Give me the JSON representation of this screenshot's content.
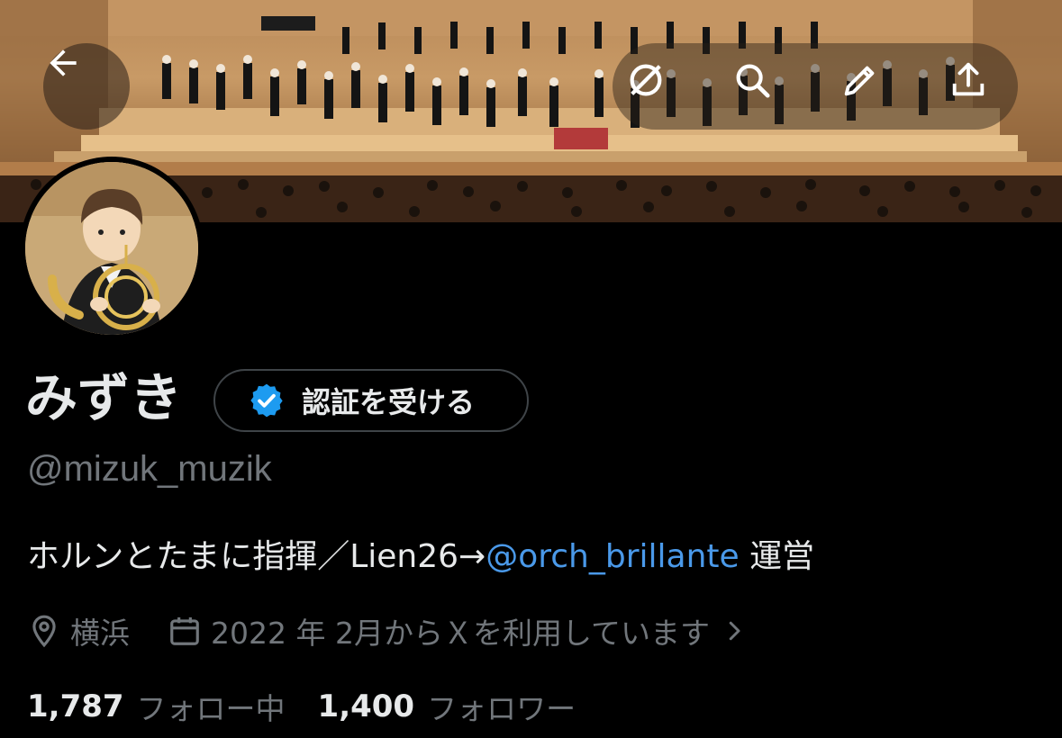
{
  "banner": {
    "description_icon": "orchestra-concert-photo"
  },
  "top_bar": {
    "back_icon": "arrow-left-icon",
    "actions": [
      "grok-icon",
      "search-icon",
      "edit-icon",
      "share-icon"
    ]
  },
  "profile": {
    "display_name": "みずき",
    "verify_button_label": "認証を受ける",
    "handle": "@mizuk_muzik",
    "bio_text": "ホルンとたまに指揮／Lien26→",
    "bio_mention": "@orch_brillante",
    "bio_suffix": " 運営",
    "location": "横浜",
    "joined": "2022 年 2月からＸを利用しています",
    "following_count": "1,787",
    "following_label": "フォロー中",
    "followers_count": "1,400",
    "followers_label": "フォロワー"
  },
  "colors": {
    "background": "#000000",
    "text_primary": "#e7e9ea",
    "text_secondary": "#71767b",
    "link": "#4a99e9",
    "verified_badge": "#1d9bf0"
  }
}
